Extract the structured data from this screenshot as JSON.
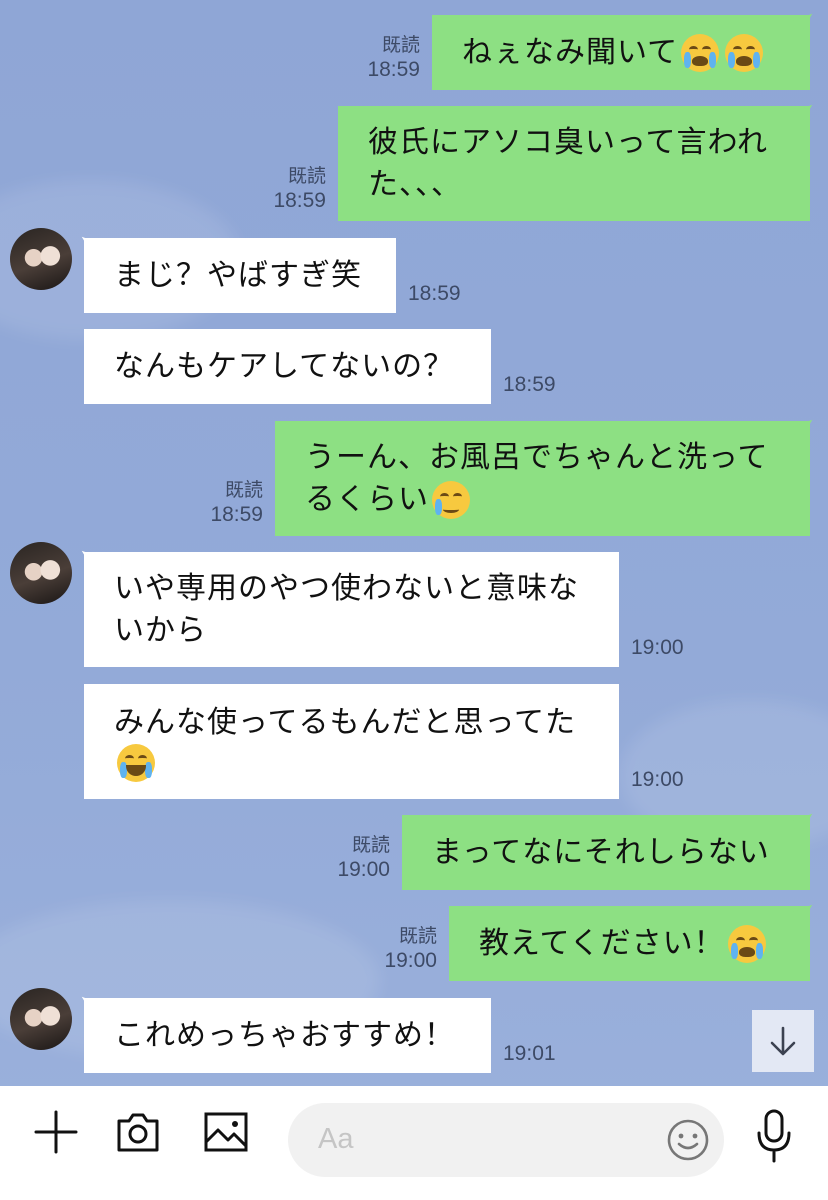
{
  "colors": {
    "background": "#93aad8",
    "outgoing_bubble": "#8de083",
    "incoming_bubble": "#ffffff",
    "meta_text": "#3d4a66"
  },
  "messages": [
    {
      "dir": "out",
      "text": "ねぇなみ聞いて",
      "emojis": [
        "loudly-crying-face",
        "loudly-crying-face"
      ],
      "read": "既読",
      "time": "18:59"
    },
    {
      "dir": "out",
      "lines": [
        "彼氏にアソコ臭いって言われ",
        "た、、、"
      ],
      "read": "既読",
      "time": "18:59"
    },
    {
      "dir": "in",
      "text": "まじ？やばすぎ笑",
      "time": "18:59"
    },
    {
      "dir": "in",
      "text": "なんもケアしてないの？",
      "time": "18:59"
    },
    {
      "dir": "out",
      "lines": [
        "うーん、お風呂でちゃんと洗って",
        "るくらい"
      ],
      "emojis": [
        "smiling-face-with-tear"
      ],
      "read": "既読",
      "time": "18:59"
    },
    {
      "dir": "in",
      "lines": [
        "いや専用のやつ使わないと意味な",
        "いから"
      ],
      "time": "19:00"
    },
    {
      "dir": "in",
      "lines": [
        "みんな使ってるもんだと思ってた"
      ],
      "emojis": [
        "face-with-tears-of-joy"
      ],
      "time": "19:00"
    },
    {
      "dir": "out",
      "text": "まってなにそれしらない",
      "read": "既読",
      "time": "19:00"
    },
    {
      "dir": "out",
      "text": "教えてください！",
      "emojis": [
        "loudly-crying-face"
      ],
      "read": "既読",
      "time": "19:00"
    },
    {
      "dir": "in",
      "text": "これめっちゃおすすめ！",
      "time": "19:01"
    }
  ],
  "input": {
    "placeholder": "Aa"
  },
  "toolbar": {
    "icons": [
      "plus-icon",
      "camera-icon",
      "image-icon",
      "emoji-icon",
      "microphone-icon"
    ],
    "scroll_icon": "arrow-down-icon"
  }
}
